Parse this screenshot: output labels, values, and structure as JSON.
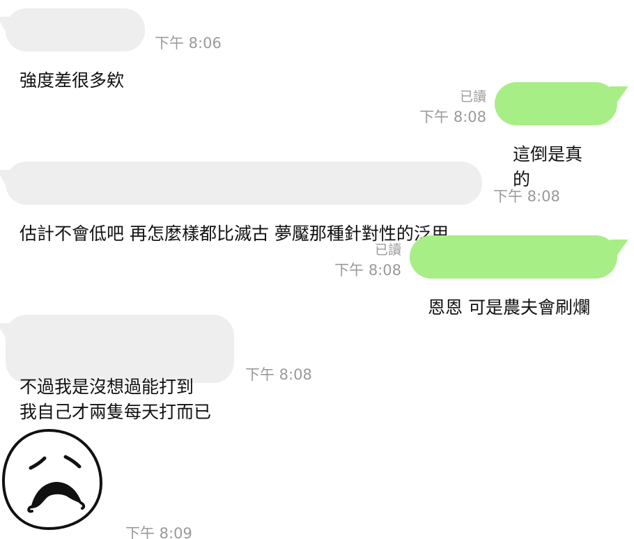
{
  "messages": [
    {
      "direction": "in",
      "text": "強度差很多欸",
      "time": "下午 8:06"
    },
    {
      "direction": "out",
      "text": "這倒是真的",
      "time": "下午 8:08",
      "read": "已讀"
    },
    {
      "direction": "in",
      "text": "估計不會低吧 再怎麼樣都比滅古 夢魘那種針對性的泛用",
      "time": "下午 8:08"
    },
    {
      "direction": "out",
      "text": "恩恩  可是農夫會刷爛",
      "time": "下午 8:08",
      "read": "已讀"
    },
    {
      "direction": "in",
      "text": "不過我是沒想過能打到\n我自己才兩隻每天打而已",
      "time": "下午 8:08"
    },
    {
      "direction": "in",
      "sticker": "sad-face-sticker",
      "time": "下午 8:09"
    }
  ],
  "colors": {
    "incoming_bubble": "#eeeeee",
    "outgoing_bubble": "#a7ee86",
    "meta_text": "#9a9a9a"
  }
}
